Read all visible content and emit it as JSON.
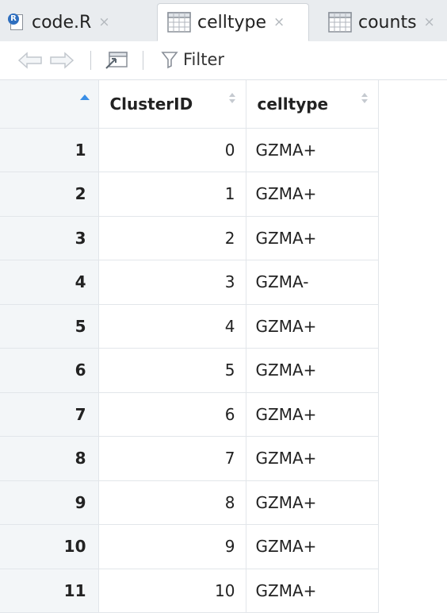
{
  "tabs": [
    {
      "label": "code.R",
      "icon": "r-script-icon",
      "close": "×",
      "active": false
    },
    {
      "label": "celltype",
      "icon": "table-icon",
      "close": "×",
      "active": true
    },
    {
      "label": "counts",
      "icon": "table-icon",
      "close": "×",
      "active": false
    }
  ],
  "toolbar": {
    "back_icon": "back-arrow-icon",
    "forward_icon": "forward-arrow-icon",
    "popout_icon": "popout-window-icon",
    "filter_label": "Filter"
  },
  "table": {
    "columns": [
      "ClusterID",
      "celltype"
    ],
    "rows": [
      {
        "index": "1",
        "cluster": "0",
        "celltype": "GZMA+"
      },
      {
        "index": "2",
        "cluster": "1",
        "celltype": "GZMA+"
      },
      {
        "index": "3",
        "cluster": "2",
        "celltype": "GZMA+"
      },
      {
        "index": "4",
        "cluster": "3",
        "celltype": "GZMA-"
      },
      {
        "index": "5",
        "cluster": "4",
        "celltype": "GZMA+"
      },
      {
        "index": "6",
        "cluster": "5",
        "celltype": "GZMA+"
      },
      {
        "index": "7",
        "cluster": "6",
        "celltype": "GZMA+"
      },
      {
        "index": "8",
        "cluster": "7",
        "celltype": "GZMA+"
      },
      {
        "index": "9",
        "cluster": "8",
        "celltype": "GZMA+"
      },
      {
        "index": "10",
        "cluster": "9",
        "celltype": "GZMA+"
      },
      {
        "index": "11",
        "cluster": "10",
        "celltype": "GZMA+"
      }
    ]
  },
  "colors": {
    "sort_active": "#3a8ee6",
    "index_column_bg": "#f3f6f8",
    "tab_strip_bg": "#e9ecef"
  }
}
